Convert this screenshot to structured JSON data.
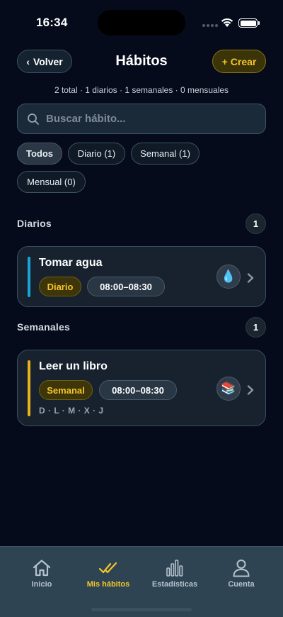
{
  "status_bar": {
    "time": "16:34"
  },
  "header": {
    "back_label": "Volver",
    "title": "Hábitos",
    "create_label": "Crear"
  },
  "summary": "2 total · 1 diarios · 1 semanales · 0 mensuales",
  "search": {
    "placeholder": "Buscar hábito..."
  },
  "filters": [
    {
      "label": "Todos",
      "active": true
    },
    {
      "label": "Diario (1)"
    },
    {
      "label": "Semanal (1)"
    },
    {
      "label": "Mensual (0)"
    }
  ],
  "sections": [
    {
      "title": "Diarios",
      "count": "1",
      "habits": [
        {
          "name": "Tomar agua",
          "frequency": "Diario",
          "time": "08:00–08:30",
          "emoji": "💧",
          "accent": "#1aa3d6"
        }
      ]
    },
    {
      "title": "Semanales",
      "count": "1",
      "habits": [
        {
          "name": "Leer un libro",
          "frequency": "Semanal",
          "time": "08:00–08:30",
          "days": "D · L · M · X · J",
          "emoji": "📚",
          "accent": "#e9b31c"
        }
      ]
    }
  ],
  "tabbar": [
    {
      "label": "Inicio",
      "icon": "home-icon"
    },
    {
      "label": "Mis hábitos",
      "icon": "double-check-icon",
      "active": true
    },
    {
      "label": "Estadísticas",
      "icon": "bar-chart-icon"
    },
    {
      "label": "Cuenta",
      "icon": "user-icon"
    }
  ],
  "colors": {
    "background": "#050b1a",
    "accent": "#f4c52a",
    "tabbar": "#2e4453"
  }
}
